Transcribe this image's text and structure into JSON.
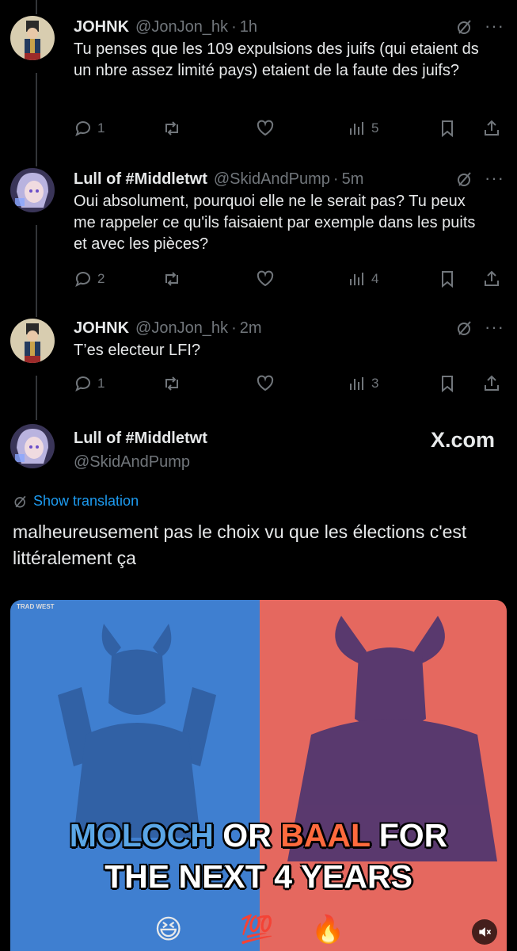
{
  "tweets": [
    {
      "name": "JOHNK",
      "handle": "@JonJon_hk",
      "time": "1h",
      "text": "Tu penses que les 109 expulsions des juifs (qui etaient ds un nbre assez limité pays) etaient de la faute des juifs?",
      "replies": "1",
      "retweets": "",
      "likes": "",
      "views": "5",
      "avatar": "soldier"
    },
    {
      "name": "Lull of #Middletwt",
      "handle": "@SkidAndPump",
      "time": "5m",
      "text": "Oui absolument, pourquoi elle ne le serait pas? Tu peux me rappeler ce qu'ils faisaient par exemple dans les puits et avec les pièces?",
      "replies": "2",
      "retweets": "",
      "likes": "",
      "views": "4",
      "avatar": "anime"
    },
    {
      "name": "JOHNK",
      "handle": "@JonJon_hk",
      "time": "2m",
      "text": "T’es electeur LFI?",
      "replies": "1",
      "retweets": "",
      "likes": "",
      "views": "3",
      "avatar": "soldier"
    }
  ],
  "main_tweet": {
    "name": "Lull of #Middletwt",
    "handle": "@SkidAndPump",
    "watermark": "X.com",
    "show_translation": "Show translation",
    "text": "malheureusement pas le choix vu que les élections c'est littéralement ça",
    "media": {
      "watermark_text": "TRAD WEST",
      "caption_line1_part1": "MOLOCH",
      "caption_line1_part2": " OR ",
      "caption_line1_part3": "BAAL",
      "caption_line1_part4": " FOR",
      "caption_line2": "THE NEXT 4 YEARS",
      "emoji_1": "😆",
      "emoji_2": "💯",
      "emoji_3": "🔥"
    }
  },
  "colors": {
    "background": "#000000",
    "text": "#e7e9ea",
    "muted": "#71767b",
    "accent": "#1d9bf0",
    "left_panel": "#3f7fd0",
    "right_panel": "#e5685f"
  },
  "icons": [
    "reply-icon",
    "retweet-icon",
    "like-icon",
    "views-icon",
    "bookmark-icon",
    "share-icon",
    "grok-icon",
    "more-icon",
    "translate-icon",
    "mute-icon"
  ]
}
